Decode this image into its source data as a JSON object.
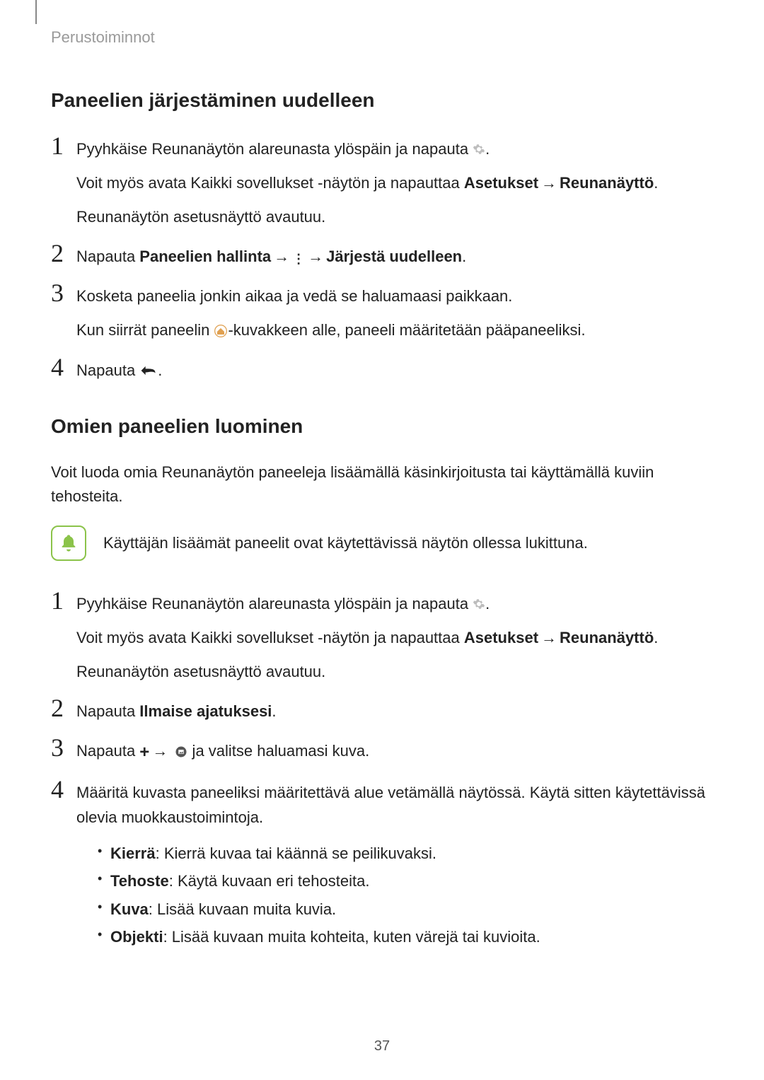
{
  "breadcrumb": "Perustoiminnot",
  "section1": {
    "heading": "Paneelien järjestäminen uudelleen",
    "step1_a": "Pyyhkäise Reunanäytön alareunasta ylöspäin ja napauta ",
    "step1_b": ".",
    "step1_c1": "Voit myös avata Kaikki sovellukset -näytön ja napauttaa ",
    "step1_c2": "Asetukset",
    "step1_c3": "Reunanäyttö",
    "step1_d": "Reunanäytön asetusnäyttö avautuu.",
    "step2_a": "Napauta ",
    "step2_b": "Paneelien hallinta",
    "step2_c": "Järjestä uudelleen",
    "step3_a": "Kosketa paneelia jonkin aikaa ja vedä se haluamaasi paikkaan.",
    "step3_b1": "Kun siirrät paneelin ",
    "step3_b2": "-kuvakkeen alle, paneeli määritetään pääpaneeliksi.",
    "step4_a": "Napauta ",
    "step4_b": "."
  },
  "section2": {
    "heading": "Omien paneelien luominen",
    "intro": "Voit luoda omia Reunanäytön paneeleja lisäämällä käsinkirjoitusta tai käyttämällä kuviin tehosteita.",
    "note": "Käyttäjän lisäämät paneelit ovat käytettävissä näytön ollessa lukittuna.",
    "step1_a": "Pyyhkäise Reunanäytön alareunasta ylöspäin ja napauta ",
    "step1_b": ".",
    "step1_c1": "Voit myös avata Kaikki sovellukset -näytön ja napauttaa ",
    "step1_c2": "Asetukset",
    "step1_c3": "Reunanäyttö",
    "step1_d": "Reunanäytön asetusnäyttö avautuu.",
    "step2_a": "Napauta ",
    "step2_b": "Ilmaise ajatuksesi",
    "step3_a": "Napauta ",
    "step3_b": " ja valitse haluamasi kuva.",
    "step4_a": "Määritä kuvasta paneeliksi määritettävä alue vetämällä näytössä. Käytä sitten käytettävissä olevia muokkaustoimintoja.",
    "bullets": [
      {
        "label": "Kierrä",
        "desc": ": Kierrä kuvaa tai käännä se peilikuvaksi."
      },
      {
        "label": "Tehoste",
        "desc": ": Käytä kuvaan eri tehosteita."
      },
      {
        "label": "Kuva",
        "desc": ": Lisää kuvaan muita kuvia."
      },
      {
        "label": "Objekti",
        "desc": ": Lisää kuvaan muita kohteita, kuten värejä tai kuvioita."
      }
    ]
  },
  "arrow": "→",
  "page_number": "37",
  "nums": {
    "n1": "1",
    "n2": "2",
    "n3": "3",
    "n4": "4"
  }
}
